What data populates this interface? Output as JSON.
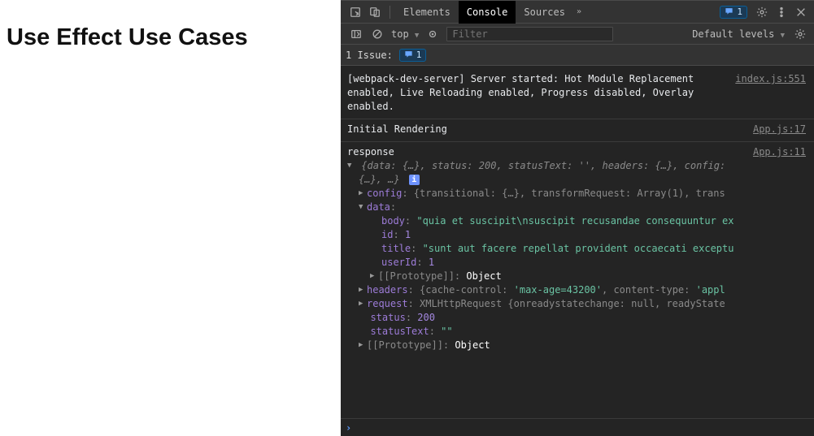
{
  "page": {
    "heading": "Use Effect Use Cases"
  },
  "devtools": {
    "tabs": {
      "elements": "Elements",
      "console": "Console",
      "sources": "Sources"
    },
    "issues_pill": "1",
    "toolbar": {
      "scope": "top",
      "filter_placeholder": "Filter",
      "levels": "Default levels"
    },
    "issues_row": {
      "label": "1 Issue:",
      "count": "1"
    },
    "log1": {
      "text": "[webpack-dev-server] Server started: Hot Module Replacement enabled, Live Reloading enabled, Progress disabled, Overlay enabled.",
      "source": "index.js:551"
    },
    "log2": {
      "text": "Initial Rendering",
      "source": "App.js:17"
    },
    "log3": {
      "label": "response",
      "source": "App.js:11",
      "summary_data": "data: {…}",
      "summary_status": "status: 200",
      "summary_statusText": "statusText: ''",
      "summary_headers": "headers: {…}",
      "summary_config": "config:",
      "summary_tail": "{…}, …}",
      "config_key": "config",
      "config_val": ": {transitional: {…}, transformRequest: Array(1), trans",
      "data_key": "data",
      "body_key": "body",
      "body_val": "\"quia et suscipit\\nsuscipit recusandae consequuntur ex",
      "id_key": "id",
      "id_val": "1",
      "title_key": "title",
      "title_val": "\"sunt aut facere repellat provident occaecati exceptu",
      "userId_key": "userId",
      "userId_val": "1",
      "proto_key": "[[Prototype]]",
      "proto_val": "Object",
      "headers_key": "headers",
      "headers_val_pre": ": {cache-control: ",
      "headers_maxage": "'max-age=43200'",
      "headers_val_post": ", content-type: ",
      "headers_ct": "'appl",
      "request_key": "request",
      "request_val": ": XMLHttpRequest {onreadystatechange: null, readyState",
      "status_key": "status",
      "status_val": "200",
      "statusText_key": "statusText",
      "statusText_val": "\"\"",
      "proto2_key": "[[Prototype]]",
      "proto2_val": "Object"
    }
  }
}
